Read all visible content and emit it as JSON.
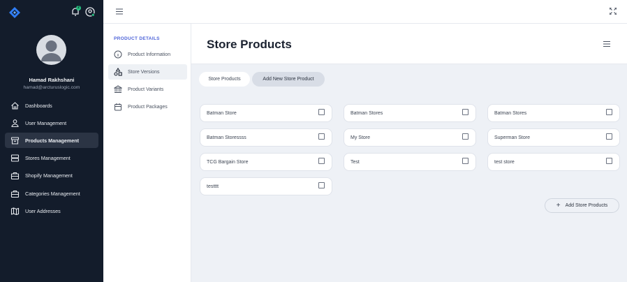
{
  "sidebar": {
    "notification_count": "2",
    "user": {
      "name": "Hamad Rakhshani",
      "email": "hamad@arcturuslogic.com"
    },
    "nav": [
      {
        "label": "Dashboards",
        "icon": "home-icon"
      },
      {
        "label": "User Management",
        "icon": "users-icon"
      },
      {
        "label": "Products Management",
        "icon": "archive-box-icon",
        "active": true
      },
      {
        "label": "Stores Management",
        "icon": "inbox-stack-icon"
      },
      {
        "label": "Shopify Management",
        "icon": "briefcase-icon"
      },
      {
        "label": "Categories Management",
        "icon": "briefcase-icon"
      },
      {
        "label": "User Addresses",
        "icon": "map-icon"
      }
    ]
  },
  "subnav": {
    "heading": "PRODUCT DETAILS",
    "items": [
      {
        "label": "Product Information",
        "icon": "info-circle-icon"
      },
      {
        "label": "Store Versions",
        "icon": "shapes-icon",
        "active": true
      },
      {
        "label": "Product Variants",
        "icon": "building-columns-icon"
      },
      {
        "label": "Product Packages",
        "icon": "calendar-icon"
      }
    ]
  },
  "main": {
    "title": "Store Products",
    "tabs": [
      "Store Products",
      "Add New Store Product"
    ],
    "stores": [
      "Batman Store",
      "Batman Stores",
      "Batman Stores",
      "Batman Storessss",
      "My Store",
      "Superman Store",
      "TCG Bargain Store",
      "Test",
      "test store",
      "testttt"
    ],
    "add_button": "Add Store Products"
  },
  "colors": {
    "sidebar_bg": "#131c2b",
    "accent": "#4d63d8",
    "content_bg": "#eef1f6",
    "badge": "#27c281"
  }
}
